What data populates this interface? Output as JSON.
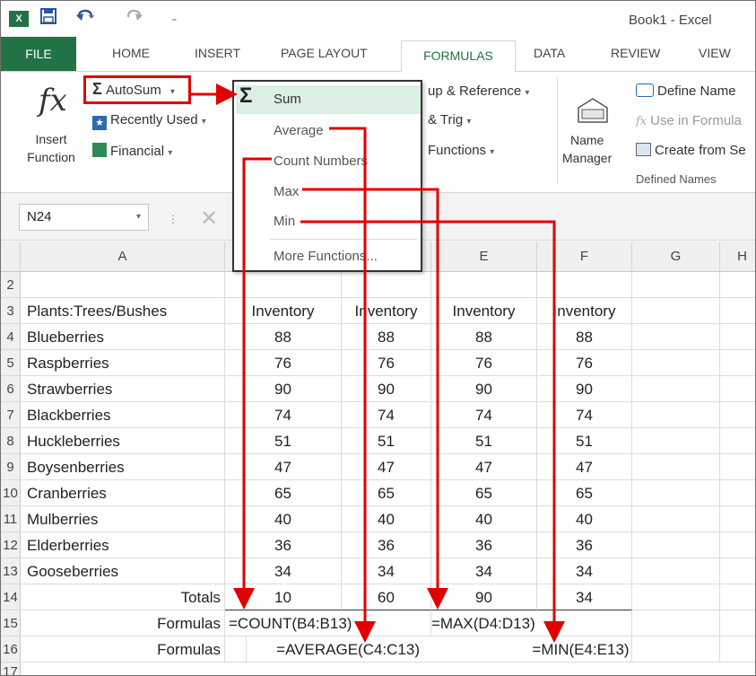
{
  "app": {
    "logo": "X",
    "window_title": "Book1 - Excel",
    "undo_icon": "undo-icon",
    "redo_icon": "redo-icon",
    "save_icon": "save-icon"
  },
  "tabs": [
    {
      "label": "FILE"
    },
    {
      "label": "HOME"
    },
    {
      "label": "INSERT"
    },
    {
      "label": "PAGE LAYOUT"
    },
    {
      "label": "FORMULAS",
      "active": true
    },
    {
      "label": "DATA"
    },
    {
      "label": "REVIEW"
    },
    {
      "label": "VIEW"
    }
  ],
  "ribbon": {
    "fx_symbol": "fx",
    "insert_function_line1": "Insert",
    "insert_function_line2": "Function",
    "autosum": "AutoSum",
    "recently_used": "Recently Used",
    "financial": "Financial",
    "lookup": "up & Reference",
    "math": "& Trig",
    "more_functions": "Functions",
    "name_manager_line1": "Name",
    "name_manager_line2": "Manager",
    "define_name": "Define Name",
    "use_in_formula": "Use in Formula",
    "create_from_selection": "Create from Se",
    "defined_names_group": "Defined Names",
    "dropdown_caret": "▾"
  },
  "autosum_menu": {
    "items": [
      "Sum",
      "Average",
      "Count Numbers",
      "Max",
      "Min",
      "More Functions..."
    ]
  },
  "formula_bar": {
    "name_box": "N24"
  },
  "columns": [
    "A",
    "",
    "",
    "E",
    "F",
    "G",
    "H"
  ],
  "rows": [
    {
      "num": "2",
      "a": "",
      "b": "",
      "c": "",
      "d": "",
      "e": ""
    },
    {
      "num": "3",
      "a": "Plants:Trees/Bushes",
      "b": "Inventory",
      "c": "Inventory",
      "d": "Inventory",
      "e": "Inventory"
    },
    {
      "num": "4",
      "a": "Blueberries",
      "b": "88",
      "c": "88",
      "d": "88",
      "e": "88"
    },
    {
      "num": "5",
      "a": "Raspberries",
      "b": "76",
      "c": "76",
      "d": "76",
      "e": "76"
    },
    {
      "num": "6",
      "a": "Strawberries",
      "b": "90",
      "c": "90",
      "d": "90",
      "e": "90"
    },
    {
      "num": "7",
      "a": "Blackberries",
      "b": "74",
      "c": "74",
      "d": "74",
      "e": "74"
    },
    {
      "num": "8",
      "a": "Huckleberries",
      "b": "51",
      "c": "51",
      "d": "51",
      "e": "51"
    },
    {
      "num": "9",
      "a": "Boysenberries",
      "b": "47",
      "c": "47",
      "d": "47",
      "e": "47"
    },
    {
      "num": "10",
      "a": "Cranberries",
      "b": "65",
      "c": "65",
      "d": "65",
      "e": "65"
    },
    {
      "num": "11",
      "a": "Mulberries",
      "b": "40",
      "c": "40",
      "d": "40",
      "e": "40"
    },
    {
      "num": "12",
      "a": "Elderberries",
      "b": "36",
      "c": "36",
      "d": "36",
      "e": "36"
    },
    {
      "num": "13",
      "a": "Gooseberries",
      "b": "34",
      "c": "34",
      "d": "34",
      "e": "34"
    },
    {
      "num": "14",
      "a": "Totals",
      "b": "10",
      "c": "60",
      "d": "90",
      "e": "34"
    }
  ],
  "formula_rows": {
    "row15_num": "15",
    "row15_label": "Formulas",
    "row15_f1": "=COUNT(B4:B13)",
    "row15_f2": "=MAX(D4:D13)",
    "row16_num": "16",
    "row16_label": "Formulas",
    "row16_f1": "=AVERAGE(C4:C13)",
    "row16_f2": "=MIN(E4:E13)",
    "row17_num": "17"
  },
  "colors": {
    "excel_green": "#217346",
    "annotation_red": "#e00000"
  }
}
